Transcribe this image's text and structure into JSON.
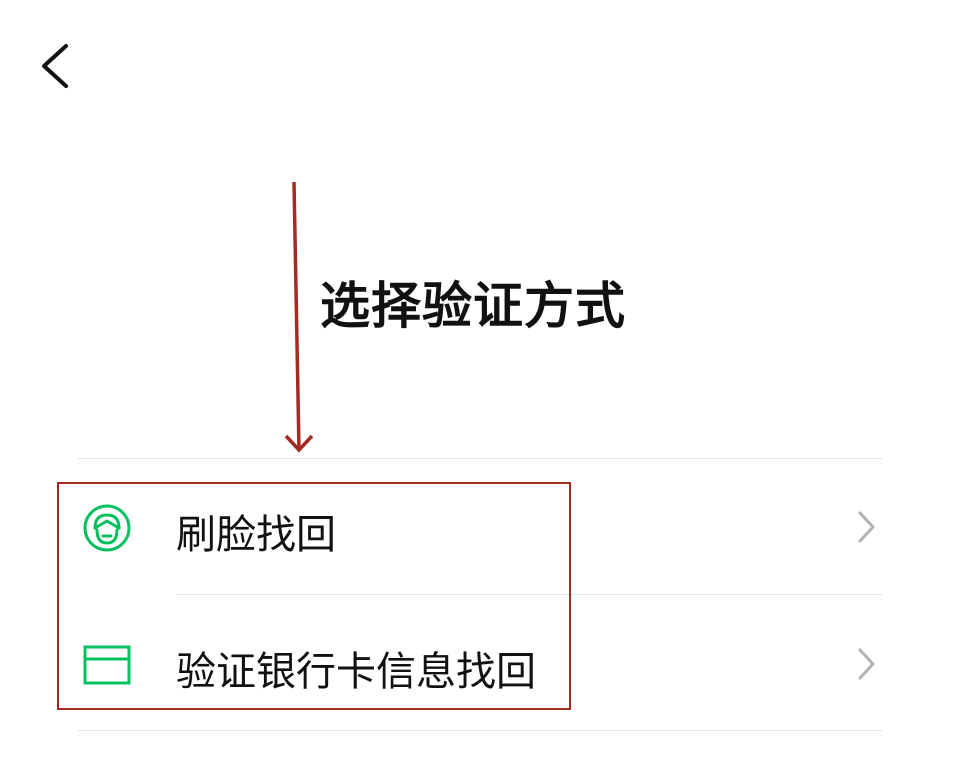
{
  "nav": {
    "back_icon": "chevron-left-icon"
  },
  "page": {
    "title": "选择验证方式"
  },
  "options": [
    {
      "label": "刷脸找回",
      "icon": "face-recognition-icon",
      "chevron_icon": "chevron-right-icon"
    },
    {
      "label": "验证银行卡信息找回",
      "icon": "bank-card-icon",
      "chevron_icon": "chevron-right-icon"
    }
  ],
  "colors": {
    "accent_green": "#07c160",
    "annotation_red": "#a52a22",
    "divider": "#e5e5e5",
    "chevron": "#b2b2b2",
    "text": "#111111"
  }
}
